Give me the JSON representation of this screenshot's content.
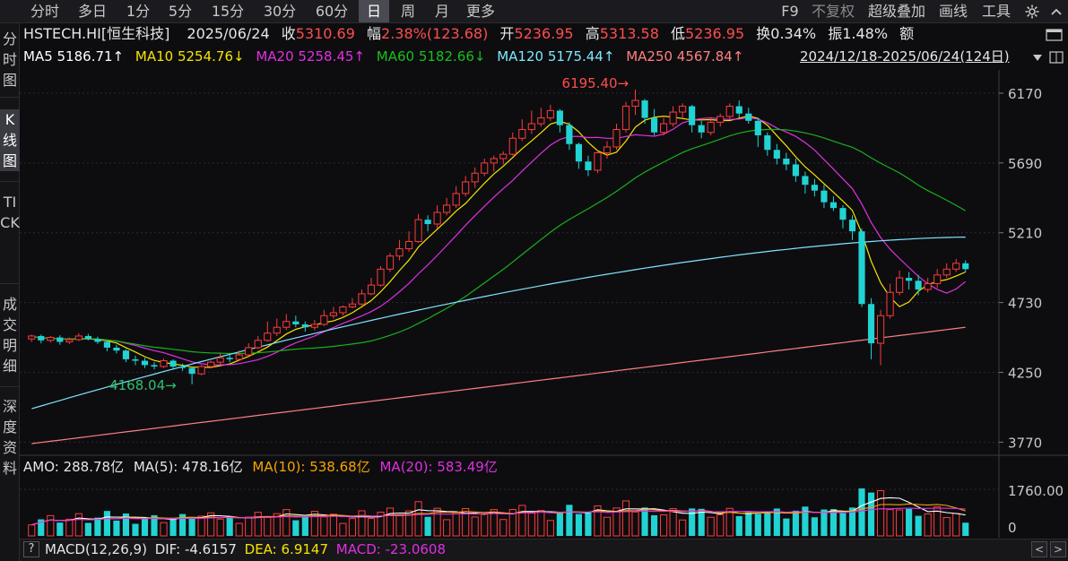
{
  "toolbar": {
    "tabs": [
      "分时",
      "多日",
      "1分",
      "5分",
      "15分",
      "30分",
      "60分",
      "日",
      "周",
      "月",
      "更多"
    ],
    "active_tab": "日",
    "right": [
      "F9",
      "不复权",
      "超级叠加",
      "画线",
      "工具"
    ]
  },
  "sidebar": {
    "tabs": [
      "分时图",
      "K线图",
      "TICK",
      "成交明细",
      "深度资料"
    ],
    "active": "K线图"
  },
  "quote": {
    "symbol": "HSTECH.HI[恒生科技]",
    "date": "2025/06/24",
    "close_label": "收",
    "close": "5310.69",
    "change_label": "幅",
    "change": "2.38%(123.68)",
    "open_label": "开",
    "open": "5236.95",
    "high_label": "高",
    "high": "5313.58",
    "low_label": "低",
    "low": "5236.95",
    "turnover_label": "换",
    "turnover": "0.34%",
    "amplitude_label": "振",
    "amplitude": "1.48%",
    "amount_label": "额"
  },
  "ma_legend": {
    "ma5": "MA5 5186.71↑",
    "ma10": "MA10 5254.76↓",
    "ma20": "MA20 5258.45↑",
    "ma60": "MA60 5182.66↓",
    "ma120": "MA120 5175.44↑",
    "ma250": "MA250 4567.84↑",
    "range": "2024/12/18-2025/06/24(124日)"
  },
  "volume_legend": {
    "amo": "AMO: 288.78亿",
    "ma5": "MA(5): 478.16亿",
    "ma10": "MA(10): 538.68亿",
    "ma20": "MA(20): 583.49亿"
  },
  "macd_legend": {
    "label": "MACD(12,26,9)",
    "dif": "DIF: -4.6157",
    "dea": "DEA: 6.9147",
    "macd": "MACD: -23.0608"
  },
  "colors": {
    "up": "#ff3b3b",
    "down": "#22d3d3",
    "ma5": "#ffffff",
    "ma10": "#f5e400",
    "ma20": "#e030e0",
    "ma60": "#19b019",
    "ma120": "#80e6ff",
    "ma250": "#ff8080"
  },
  "chart_data": {
    "type": "candlestick",
    "y_ticks": [
      6170,
      5690,
      5210,
      4730,
      4250,
      3770
    ],
    "ylim": [
      3680,
      6330
    ],
    "volume_ticks": [
      "1760.00",
      "0"
    ],
    "high_annotation": "6195.40",
    "low_annotation": "4168.04",
    "candles": [
      [
        4480,
        4500,
        4460,
        4510
      ],
      [
        4500,
        4470,
        4450,
        4510
      ],
      [
        4470,
        4490,
        4455,
        4500
      ],
      [
        4490,
        4460,
        4440,
        4505
      ],
      [
        4460,
        4475,
        4445,
        4490
      ],
      [
        4475,
        4500,
        4465,
        4520
      ],
      [
        4500,
        4480,
        4470,
        4515
      ],
      [
        4480,
        4460,
        4445,
        4495
      ],
      [
        4460,
        4420,
        4395,
        4470
      ],
      [
        4420,
        4400,
        4380,
        4440
      ],
      [
        4400,
        4340,
        4320,
        4410
      ],
      [
        4340,
        4330,
        4300,
        4365
      ],
      [
        4330,
        4300,
        4280,
        4350
      ],
      [
        4300,
        4290,
        4270,
        4320
      ],
      [
        4290,
        4330,
        4280,
        4345
      ],
      [
        4330,
        4290,
        4275,
        4340
      ],
      [
        4290,
        4280,
        4260,
        4310
      ],
      [
        4280,
        4240,
        4168,
        4290
      ],
      [
        4240,
        4290,
        4230,
        4300
      ],
      [
        4290,
        4320,
        4280,
        4330
      ],
      [
        4320,
        4350,
        4300,
        4380
      ],
      [
        4350,
        4340,
        4320,
        4370
      ],
      [
        4340,
        4370,
        4330,
        4400
      ],
      [
        4370,
        4420,
        4360,
        4450
      ],
      [
        4420,
        4470,
        4410,
        4500
      ],
      [
        4470,
        4520,
        4460,
        4600
      ],
      [
        4520,
        4560,
        4500,
        4620
      ],
      [
        4560,
        4600,
        4540,
        4650
      ],
      [
        4600,
        4580,
        4560,
        4640
      ],
      [
        4580,
        4560,
        4530,
        4600
      ],
      [
        4560,
        4580,
        4540,
        4610
      ],
      [
        4580,
        4640,
        4570,
        4680
      ],
      [
        4640,
        4660,
        4620,
        4700
      ],
      [
        4660,
        4700,
        4640,
        4710
      ],
      [
        4700,
        4720,
        4690,
        4760
      ],
      [
        4720,
        4790,
        4710,
        4820
      ],
      [
        4790,
        4850,
        4780,
        4900
      ],
      [
        4850,
        4960,
        4840,
        4980
      ],
      [
        4960,
        5050,
        4940,
        5070
      ],
      [
        5050,
        5100,
        5020,
        5160
      ],
      [
        5100,
        5150,
        5080,
        5220
      ],
      [
        5150,
        5300,
        5140,
        5340
      ],
      [
        5300,
        5270,
        5220,
        5330
      ],
      [
        5270,
        5350,
        5240,
        5400
      ],
      [
        5350,
        5400,
        5330,
        5450
      ],
      [
        5400,
        5480,
        5380,
        5530
      ],
      [
        5480,
        5560,
        5460,
        5600
      ],
      [
        5560,
        5620,
        5520,
        5660
      ],
      [
        5620,
        5690,
        5600,
        5720
      ],
      [
        5690,
        5720,
        5630,
        5740
      ],
      [
        5720,
        5750,
        5680,
        5770
      ],
      [
        5750,
        5860,
        5740,
        5900
      ],
      [
        5860,
        5920,
        5840,
        5990
      ],
      [
        5920,
        5960,
        5890,
        6050
      ],
      [
        5960,
        6000,
        5940,
        6070
      ],
      [
        6000,
        6050,
        5980,
        6090
      ],
      [
        6050,
        5950,
        5900,
        6060
      ],
      [
        5950,
        5820,
        5780,
        5970
      ],
      [
        5820,
        5700,
        5650,
        5830
      ],
      [
        5700,
        5640,
        5600,
        5740
      ],
      [
        5640,
        5760,
        5620,
        5780
      ],
      [
        5760,
        5800,
        5720,
        5840
      ],
      [
        5800,
        5920,
        5780,
        5960
      ],
      [
        5920,
        6080,
        5900,
        6110
      ],
      [
        6080,
        6120,
        6020,
        6195
      ],
      [
        6120,
        6000,
        5960,
        6130
      ],
      [
        6000,
        5900,
        5880,
        6060
      ],
      [
        5900,
        5960,
        5880,
        6000
      ],
      [
        5960,
        6040,
        5940,
        6080
      ],
      [
        6040,
        6080,
        6000,
        6100
      ],
      [
        6080,
        5950,
        5900,
        6090
      ],
      [
        5950,
        5900,
        5860,
        5980
      ],
      [
        5900,
        5970,
        5880,
        6000
      ],
      [
        5970,
        6010,
        5940,
        6030
      ],
      [
        6010,
        6080,
        5990,
        6100
      ],
      [
        6080,
        6030,
        6000,
        6120
      ],
      [
        6030,
        5980,
        5960,
        6070
      ],
      [
        5980,
        5880,
        5800,
        6000
      ],
      [
        5880,
        5780,
        5740,
        5900
      ],
      [
        5780,
        5720,
        5680,
        5820
      ],
      [
        5720,
        5680,
        5640,
        5760
      ],
      [
        5680,
        5600,
        5560,
        5720
      ],
      [
        5600,
        5540,
        5480,
        5630
      ],
      [
        5540,
        5500,
        5460,
        5580
      ],
      [
        5500,
        5420,
        5380,
        5540
      ],
      [
        5420,
        5380,
        5360,
        5460
      ],
      [
        5380,
        5300,
        5240,
        5400
      ],
      [
        5300,
        5220,
        5160,
        5330
      ],
      [
        5220,
        4720,
        4700,
        5240
      ],
      [
        4720,
        4450,
        4340,
        4760
      ],
      [
        4450,
        4640,
        4300,
        4680
      ],
      [
        4640,
        4800,
        4620,
        4860
      ],
      [
        4800,
        4900,
        4780,
        4950
      ],
      [
        4900,
        4880,
        4820,
        4940
      ],
      [
        4880,
        4820,
        4780,
        4920
      ],
      [
        4820,
        4860,
        4800,
        4900
      ],
      [
        4860,
        4920,
        4830,
        4960
      ],
      [
        4920,
        4960,
        4900,
        5000
      ],
      [
        4960,
        5000,
        4940,
        5030
      ],
      [
        5000,
        4960,
        4940,
        5020
      ]
    ]
  }
}
